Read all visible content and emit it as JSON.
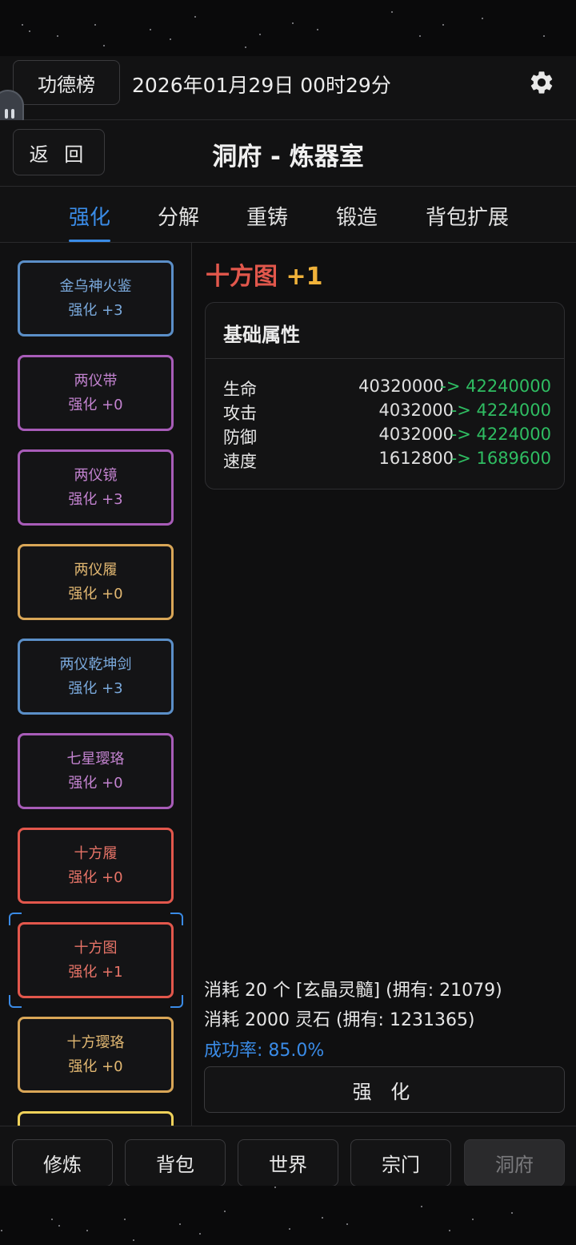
{
  "header": {
    "rank_label": "功德榜",
    "datetime": "2026年01月29日 00时29分",
    "settings_icon": "gear-icon"
  },
  "titlebar": {
    "back_label": "返 回",
    "title": "洞府 - 炼器室"
  },
  "tabs": [
    {
      "label": "强化",
      "active": true
    },
    {
      "label": "分解",
      "active": false
    },
    {
      "label": "重铸",
      "active": false
    },
    {
      "label": "锻造",
      "active": false
    },
    {
      "label": "背包扩展",
      "active": false
    }
  ],
  "colors": {
    "blue": "#5b8fc8",
    "purple": "#a85cb8",
    "orange": "#d9a657",
    "red": "#e2574c",
    "yellow": "#efd15a",
    "accent": "#3a8be6",
    "green": "#2fbd62"
  },
  "items": [
    {
      "name": "金乌神火鉴",
      "level": "强化 +3",
      "color": "#5b8fc8",
      "text": "#7aa9dc"
    },
    {
      "name": "两仪带",
      "level": "强化 +0",
      "color": "#a85cb8",
      "text": "#c383d0"
    },
    {
      "name": "两仪镜",
      "level": "强化 +3",
      "color": "#a85cb8",
      "text": "#c383d0"
    },
    {
      "name": "两仪履",
      "level": "强化 +0",
      "color": "#d9a657",
      "text": "#e2b872"
    },
    {
      "name": "两仪乾坤剑",
      "level": "强化 +3",
      "color": "#5b8fc8",
      "text": "#7aa9dc"
    },
    {
      "name": "七星璎珞",
      "level": "强化 +0",
      "color": "#a85cb8",
      "text": "#c383d0"
    },
    {
      "name": "十方履",
      "level": "强化 +0",
      "color": "#e2574c",
      "text": "#e87468"
    },
    {
      "name": "十方图",
      "level": "强化 +1",
      "color": "#e2574c",
      "text": "#e87468",
      "selected": true
    },
    {
      "name": "十方璎珞",
      "level": "强化 +0",
      "color": "#d9a657",
      "text": "#e2b872"
    },
    {
      "name": "",
      "level": "",
      "color": "#efd15a",
      "text": "#efd15a"
    }
  ],
  "detail": {
    "name": "十方图",
    "level": "+1",
    "panel_title": "基础属性",
    "attributes": [
      {
        "key": "生命",
        "current": "40320000",
        "next": "-> 42240000"
      },
      {
        "key": "攻击",
        "current": "4032000",
        "next": "-> 4224000"
      },
      {
        "key": "防御",
        "current": "4032000",
        "next": "-> 4224000"
      },
      {
        "key": "速度",
        "current": "1612800",
        "next": "-> 1689600"
      }
    ],
    "cost_material": "消耗 20 个 [玄晶灵髓] (拥有: 21079)",
    "cost_stone": "消耗 2000 灵石 (拥有: 1231365)",
    "success_rate": "成功率: 85.0%",
    "action_label": "强 化"
  },
  "bottom_nav": [
    {
      "label": "修炼",
      "disabled": false
    },
    {
      "label": "背包",
      "disabled": false
    },
    {
      "label": "世界",
      "disabled": false
    },
    {
      "label": "宗门",
      "disabled": false
    },
    {
      "label": "洞府",
      "disabled": true
    }
  ]
}
